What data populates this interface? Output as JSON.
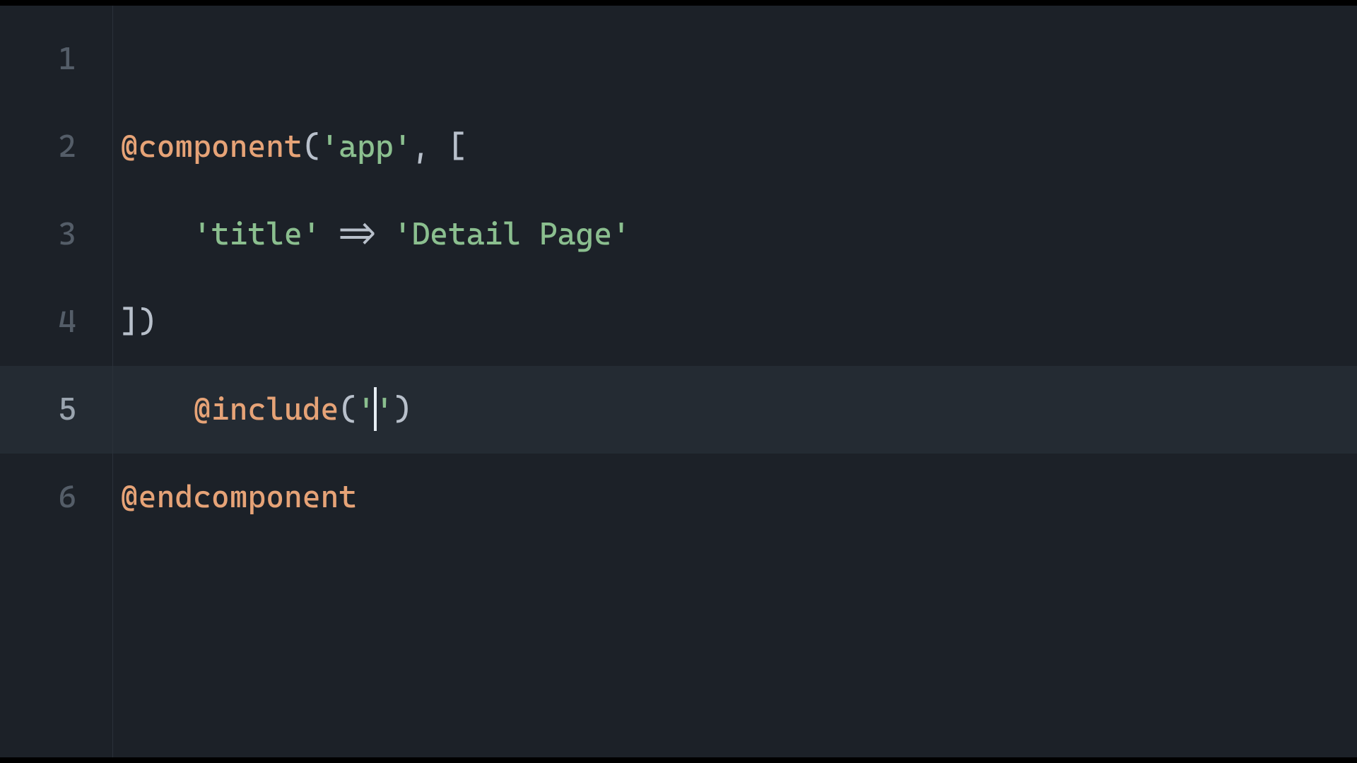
{
  "editor": {
    "active_line": 5,
    "gutter": [
      "1",
      "2",
      "3",
      "4",
      "5",
      "6"
    ],
    "lines": {
      "l2": {
        "directive": "@component",
        "open": "(",
        "str1": "'app'",
        "comma": ", [",
        "close": ""
      },
      "l3": {
        "indent": "    ",
        "key": "'title'",
        "arrow": " => ",
        "val": "'Detail Page'"
      },
      "l4": {
        "close": "])"
      },
      "l5": {
        "indent": "    ",
        "directive": "@include",
        "open": "(",
        "strL": "'",
        "strR": "'",
        "close": ")"
      },
      "l6": {
        "directive": "@endcomponent"
      }
    }
  }
}
